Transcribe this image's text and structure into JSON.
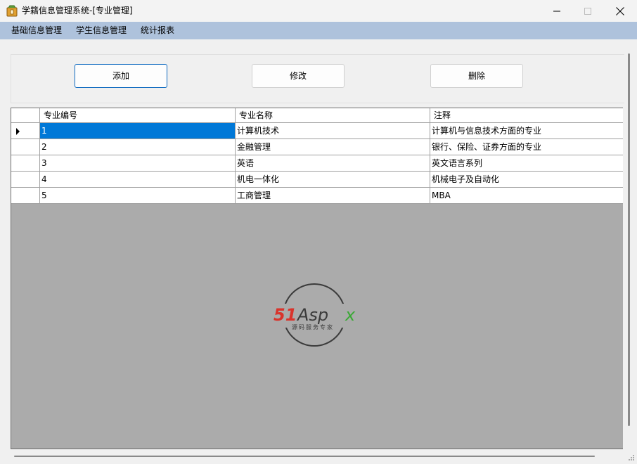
{
  "window": {
    "title": "学籍信息管理系统-[专业管理]",
    "icon": "app-package-icon",
    "controls": [
      "minimize-icon",
      "maximize-icon",
      "close-icon"
    ]
  },
  "menu": {
    "items": [
      {
        "label": "基础信息管理"
      },
      {
        "label": "学生信息管理"
      },
      {
        "label": "统计报表"
      }
    ]
  },
  "toolbar": {
    "add_label": "添加",
    "edit_label": "修改",
    "delete_label": "删除"
  },
  "grid": {
    "columns": [
      "专业编号",
      "专业名称",
      "注释"
    ],
    "current_row": 0,
    "rows": [
      {
        "id": "1",
        "name": "计算机技术",
        "note": "计算机与信息技术方面的专业"
      },
      {
        "id": "2",
        "name": "金融管理",
        "note": "银行、保险、证券方面的专业"
      },
      {
        "id": "3",
        "name": "英语",
        "note": "英文语言系列"
      },
      {
        "id": "4",
        "name": "机电一体化",
        "note": "机械电子及自动化"
      },
      {
        "id": "5",
        "name": "工商管理",
        "note": "MBA"
      }
    ]
  },
  "watermark": {
    "brand_digits": "51",
    "brand_word": "Asp",
    "brand_x": "x",
    "tagline": "源码服务专家",
    "colors": {
      "red": "#d9332b",
      "dark": "#3b3b3b",
      "green": "#3aa935"
    }
  },
  "colors": {
    "menubar": "#aec2dc",
    "selection": "#0078d7",
    "grid_background": "#ababab",
    "focus_border": "#0f6ac0"
  }
}
